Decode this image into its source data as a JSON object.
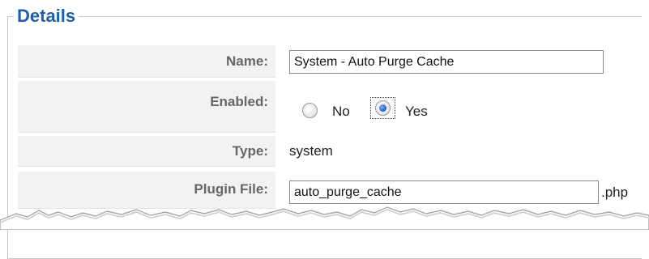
{
  "section": {
    "title": "Details"
  },
  "fields": {
    "name": {
      "label": "Name:",
      "value": "System - Auto Purge Cache"
    },
    "enabled": {
      "label": "Enabled:",
      "options": [
        {
          "label": "No",
          "checked": false
        },
        {
          "label": "Yes",
          "checked": true
        }
      ]
    },
    "type": {
      "label": "Type:",
      "value": "system"
    },
    "plugin_file": {
      "label": "Plugin File:",
      "value": "auto_purge_cache",
      "suffix": ".php"
    }
  }
}
